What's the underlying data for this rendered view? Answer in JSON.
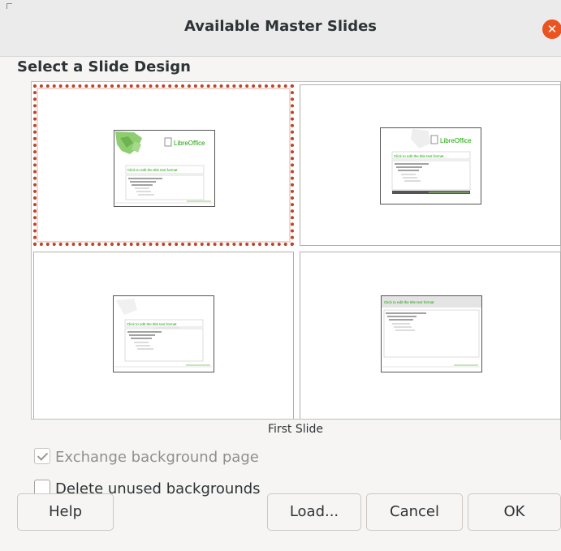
{
  "dialog": {
    "title": "Available Master Slides",
    "close_icon": "close-icon",
    "accent_color": "#e95420"
  },
  "section": {
    "heading": "Select a Slide Design"
  },
  "designs": [
    {
      "logo_text": "LibreOffice",
      "title_text": "Click to edit the title text format",
      "selected": true
    },
    {
      "logo_text": "LibreOffice",
      "title_text": "Click to edit the title text format",
      "selected": false
    },
    {
      "title_text": "Click to edit the title text format",
      "selected": false
    },
    {
      "title_text": "Click to edit the title text format",
      "selected": false
    }
  ],
  "caption": "First Slide",
  "options": {
    "exchange_background": {
      "label": "Exchange background page",
      "checked": true,
      "enabled": false
    },
    "delete_unused": {
      "label": "Delete unused backgrounds",
      "checked": false,
      "enabled": true
    }
  },
  "buttons": {
    "help": "Help",
    "load": "Load...",
    "cancel": "Cancel",
    "ok": "OK"
  }
}
